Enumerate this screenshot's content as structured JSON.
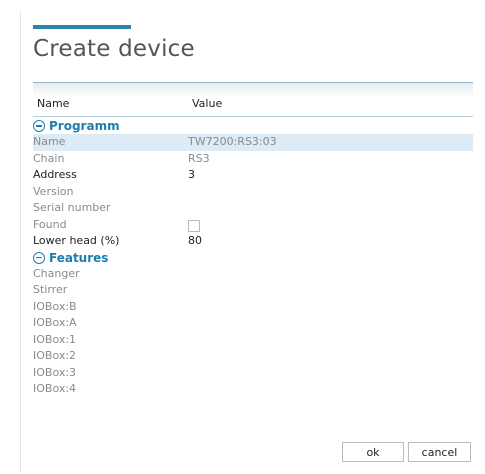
{
  "dialog": {
    "title": "Create device",
    "columns": {
      "name": "Name",
      "value": "Value"
    },
    "sections": {
      "programm": {
        "label": "Programm",
        "rows": [
          {
            "name": "Name",
            "value": "TW7200:RS3:03"
          },
          {
            "name": "Chain",
            "value": "RS3"
          },
          {
            "name": "Address",
            "value": "3"
          },
          {
            "name": "Version",
            "value": ""
          },
          {
            "name": "Serial number",
            "value": ""
          },
          {
            "name": "Found",
            "value": "",
            "checked": false
          },
          {
            "name": "Lower head (%)",
            "value": "80"
          }
        ]
      },
      "features": {
        "label": "Features",
        "rows": [
          {
            "name": "Changer"
          },
          {
            "name": "Stirrer"
          },
          {
            "name": "IOBox:B"
          },
          {
            "name": "IOBox:A"
          },
          {
            "name": "IOBox:1"
          },
          {
            "name": "IOBox:2"
          },
          {
            "name": "IOBox:3"
          },
          {
            "name": "IOBox:4"
          }
        ]
      }
    },
    "buttons": {
      "ok": "ok",
      "cancel": "cancel"
    },
    "colors": {
      "accent": "#2b86a8",
      "section": "#1f7dae",
      "selected_row": "#dcebf5"
    }
  }
}
